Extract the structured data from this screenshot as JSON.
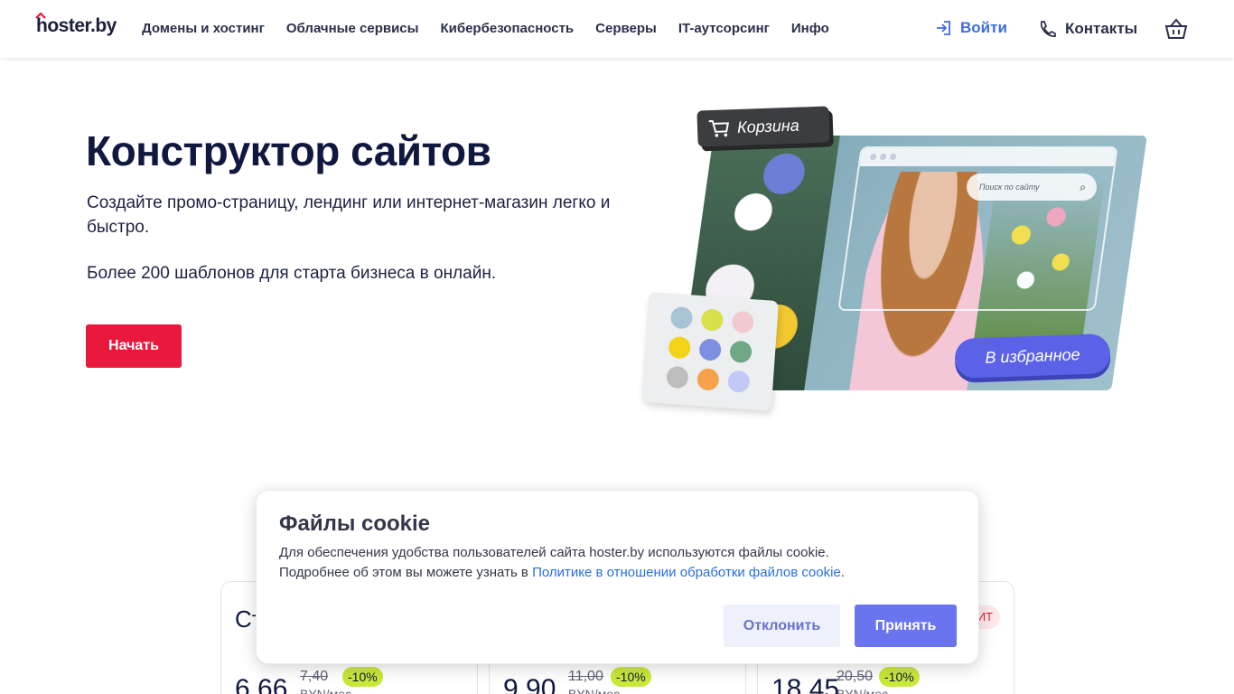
{
  "header": {
    "logo": "hoster.by",
    "nav": [
      "Домены и хостинг",
      "Облачные сервисы",
      "Кибербезопасность",
      "Серверы",
      "IT-аутсорсинг",
      "Инфо"
    ],
    "login": "Войти",
    "contacts": "Контакты"
  },
  "hero": {
    "title": "Конструктор сайтов",
    "subtitle": "Создайте промо-страницу, лендинг или интернет-магазин легко и быстро.",
    "subtitle2": "Более 200 шаблонов для старта бизнеса в онлайн.",
    "start_button": "Начать"
  },
  "illustration": {
    "cart_label": "Корзина",
    "search_placeholder": "Поиск по сайту",
    "favorite_label": "В избранное",
    "palette_colors": [
      "#a8c4d4",
      "#d8e04a",
      "#f2c9cf",
      "#f2d316",
      "#7f8fe0",
      "#6fa886",
      "#bdbdbd",
      "#f5a24a",
      "#c2c9f7"
    ]
  },
  "cards": [
    {
      "heading": "Ст",
      "price": "6,66",
      "old_price": "7,40",
      "discount": "-10%",
      "unit": "BYN/мес",
      "tag": ""
    },
    {
      "heading": "",
      "price": "9,90",
      "old_price": "11,00",
      "discount": "-10%",
      "unit": "BYN/мес",
      "tag": ""
    },
    {
      "heading": "",
      "price": "18,45",
      "old_price": "20,50",
      "discount": "-10%",
      "unit": "BYN/мес",
      "tag": "ИТ"
    }
  ],
  "cookie": {
    "title": "Файлы cookie",
    "line1": "Для обеспечения удобства пользователей сайта hoster.by используются файлы cookie.",
    "line2_prefix": "Подробнее об этом вы можете узнать в ",
    "link": "Политике в отношении обработки файлов cookie",
    "line2_suffix": ".",
    "decline": "Отклонить",
    "accept": "Принять"
  },
  "colors": {
    "accent_red": "#e8193c",
    "accent_blue": "#6b74ef",
    "link_blue": "#2a6ee8"
  }
}
